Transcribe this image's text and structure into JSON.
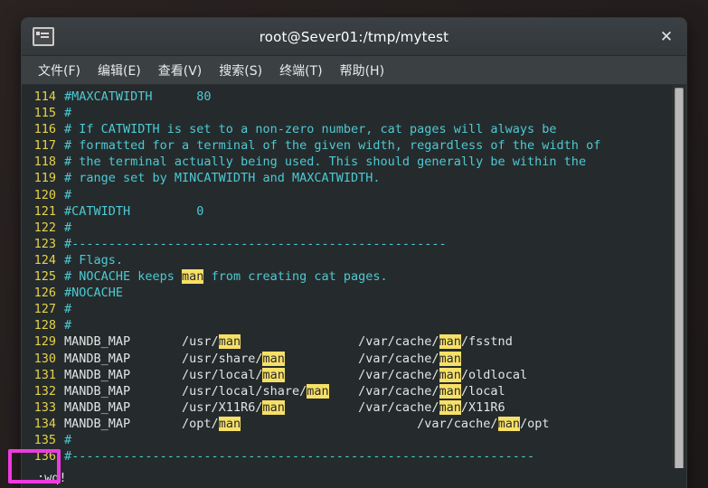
{
  "window": {
    "title": "root@Sever01:/tmp/mytest",
    "icon": "terminal-icon",
    "close_label": "✕"
  },
  "menubar": {
    "items": [
      {
        "label": "文件(F)",
        "name": "file"
      },
      {
        "label": "编辑(E)",
        "name": "edit"
      },
      {
        "label": "查看(V)",
        "name": "view"
      },
      {
        "label": "搜索(S)",
        "name": "search"
      },
      {
        "label": "终端(T)",
        "name": "terminal"
      },
      {
        "label": "帮助(H)",
        "name": "help"
      }
    ]
  },
  "editor": {
    "search_term": "man",
    "lines": [
      {
        "n": "114",
        "segs": [
          {
            "t": "#MAXCATWIDTH      80",
            "c": "comment"
          }
        ]
      },
      {
        "n": "115",
        "segs": [
          {
            "t": "#",
            "c": "comment"
          }
        ]
      },
      {
        "n": "116",
        "segs": [
          {
            "t": "# If CATWIDTH is set to a non-zero number, cat pages will always be",
            "c": "comment"
          }
        ]
      },
      {
        "n": "117",
        "segs": [
          {
            "t": "# formatted for a terminal of the given width, regardless of the width of",
            "c": "comment"
          }
        ]
      },
      {
        "n": "118",
        "segs": [
          {
            "t": "# the terminal actually being used. This should generally be within the",
            "c": "comment"
          }
        ]
      },
      {
        "n": "119",
        "segs": [
          {
            "t": "# range set by MINCATWIDTH and MAXCATWIDTH.",
            "c": "comment"
          }
        ]
      },
      {
        "n": "120",
        "segs": [
          {
            "t": "#",
            "c": "comment"
          }
        ]
      },
      {
        "n": "121",
        "segs": [
          {
            "t": "#CATWIDTH         0",
            "c": "comment"
          }
        ]
      },
      {
        "n": "122",
        "segs": [
          {
            "t": "#",
            "c": "comment"
          }
        ]
      },
      {
        "n": "123",
        "segs": [
          {
            "t": "#---------------------------------------------------",
            "c": "comment"
          }
        ]
      },
      {
        "n": "124",
        "segs": [
          {
            "t": "# Flags.",
            "c": "comment"
          }
        ]
      },
      {
        "n": "125",
        "segs": [
          {
            "t": "# NOCACHE keeps ",
            "c": "comment"
          },
          {
            "t": "man",
            "c": "match"
          },
          {
            "t": " from creating cat pages.",
            "c": "comment"
          }
        ]
      },
      {
        "n": "126",
        "segs": [
          {
            "t": "#NOCACHE",
            "c": "comment"
          }
        ]
      },
      {
        "n": "127",
        "segs": [
          {
            "t": "#",
            "c": "comment"
          }
        ]
      },
      {
        "n": "128",
        "segs": [
          {
            "t": "#",
            "c": "comment"
          }
        ]
      },
      {
        "n": "129",
        "segs": [
          {
            "t": "MANDB_MAP\t/usr/",
            "c": "plain"
          },
          {
            "t": "man",
            "c": "match"
          },
          {
            "t": "\t\t/var/cache/",
            "c": "plain"
          },
          {
            "t": "man",
            "c": "match"
          },
          {
            "t": "/fsstnd",
            "c": "plain"
          }
        ]
      },
      {
        "n": "130",
        "segs": [
          {
            "t": "MANDB_MAP\t/usr/share/",
            "c": "plain"
          },
          {
            "t": "man",
            "c": "match"
          },
          {
            "t": "\t\t/var/cache/",
            "c": "plain"
          },
          {
            "t": "man",
            "c": "match"
          }
        ]
      },
      {
        "n": "131",
        "segs": [
          {
            "t": "MANDB_MAP\t/usr/local/",
            "c": "plain"
          },
          {
            "t": "man",
            "c": "match"
          },
          {
            "t": "\t\t/var/cache/",
            "c": "plain"
          },
          {
            "t": "man",
            "c": "match"
          },
          {
            "t": "/oldlocal",
            "c": "plain"
          }
        ]
      },
      {
        "n": "132",
        "segs": [
          {
            "t": "MANDB_MAP\t/usr/local/share/",
            "c": "plain"
          },
          {
            "t": "man",
            "c": "match"
          },
          {
            "t": "\t/var/cache/",
            "c": "plain"
          },
          {
            "t": "man",
            "c": "match"
          },
          {
            "t": "/local",
            "c": "plain"
          }
        ]
      },
      {
        "n": "133",
        "segs": [
          {
            "t": "MANDB_MAP\t/usr/X11R6/",
            "c": "plain"
          },
          {
            "t": "man",
            "c": "match"
          },
          {
            "t": "\t\t/var/cache/",
            "c": "plain"
          },
          {
            "t": "man",
            "c": "match"
          },
          {
            "t": "/X11R6",
            "c": "plain"
          }
        ]
      },
      {
        "n": "134",
        "segs": [
          {
            "t": "MANDB_MAP\t/opt/",
            "c": "plain"
          },
          {
            "t": "man",
            "c": "match"
          },
          {
            "t": "\t\t\t/var/cache/",
            "c": "plain"
          },
          {
            "t": "man",
            "c": "match"
          },
          {
            "t": "/opt",
            "c": "plain"
          }
        ]
      },
      {
        "n": "135",
        "segs": [
          {
            "t": "#",
            "c": "comment"
          }
        ]
      },
      {
        "n": "136",
        "segs": [
          {
            "t": "#---------------------------------------------------------------",
            "c": "comment"
          }
        ]
      }
    ]
  },
  "statusline": {
    "command": ":wq!"
  },
  "annotation": {
    "color": "#ef3ae0",
    "target": ":wq!"
  },
  "colors": {
    "terminal_bg": "#252b2c",
    "comment": "#4ec9d4",
    "line_number": "#e6d24a",
    "plain_text": "#e4e4e4",
    "match_highlight_bg": "#f7e067",
    "titlebar_bg": "#3b4044",
    "menubar_bg": "#3b4043"
  }
}
